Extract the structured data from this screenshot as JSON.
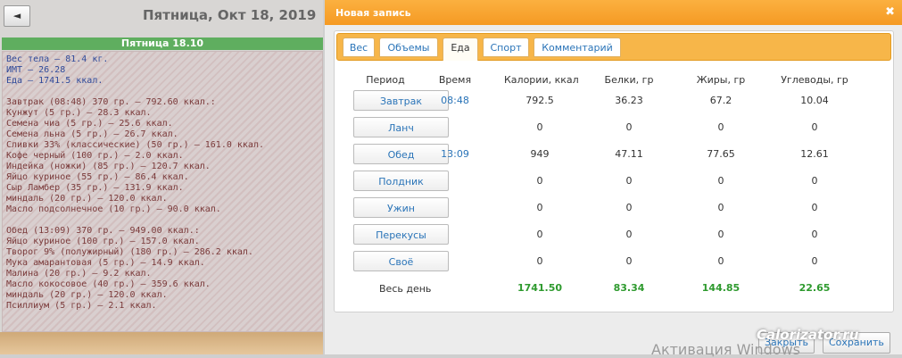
{
  "left": {
    "back_label": "◄",
    "date_title": "Пятница, Окт 18, 2019",
    "day_label": "Пятница 18.10",
    "lines": [
      {
        "text": "Вес тела — 81.4 кг.",
        "color": "blue"
      },
      {
        "text": "ИМТ — 26.28",
        "color": "blue"
      },
      {
        "text": "Еда — 1741.5 ккал.",
        "color": "blue"
      },
      {
        "text": "",
        "color": "blue"
      },
      {
        "text": "Завтрак (08:48) 370 гр. — 792.60 ккал.:",
        "color": "brown"
      },
      {
        "text": " Кунжут (5 гр.) — 28.3 ккал.",
        "color": "brown"
      },
      {
        "text": " Семена чиа (5 гр.) — 25.6 ккал.",
        "color": "brown"
      },
      {
        "text": " Семена льна (5 гр.) — 26.7 ккал.",
        "color": "brown"
      },
      {
        "text": " Сливки 33% (классические) (50 гр.) — 161.0 ккал.",
        "color": "brown"
      },
      {
        "text": " Кофе черный (100 гр.) — 2.0 ккал.",
        "color": "brown"
      },
      {
        "text": " Индейка (ножки) (85 гр.) — 120.7 ккал.",
        "color": "brown"
      },
      {
        "text": " Яйцо куриное (55 гр.) — 86.4 ккал.",
        "color": "brown"
      },
      {
        "text": " Сыр Ламбер (35 гр.) — 131.9 ккал.",
        "color": "brown"
      },
      {
        "text": " миндаль (20 гр.) — 120.0 ккал.",
        "color": "brown"
      },
      {
        "text": " Масло подсолнечное (10 гр.) — 90.0 ккал.",
        "color": "brown"
      },
      {
        "text": "",
        "color": "brown"
      },
      {
        "text": "Обед (13:09) 370 гр. — 949.00 ккал.:",
        "color": "brown"
      },
      {
        "text": " Яйцо куриное (100 гр.) — 157.0 ккал.",
        "color": "brown"
      },
      {
        "text": " Творог 9% (полужирный) (180 гр.) — 286.2 ккал.",
        "color": "brown"
      },
      {
        "text": " Мука амарантовая (5 гр.) — 14.9 ккал.",
        "color": "brown"
      },
      {
        "text": " Малина (20 гр.) — 9.2 ккал.",
        "color": "brown"
      },
      {
        "text": " Масло кокосовое (40 гр.) — 359.6 ккал.",
        "color": "brown"
      },
      {
        "text": " миндаль (20 гр.) — 120.0 ккал.",
        "color": "brown"
      },
      {
        "text": " Псиллиум (5 гр.) — 2.1 ккал.",
        "color": "brown"
      }
    ]
  },
  "dialog": {
    "title": "Новая запись",
    "close_glyph": "✖",
    "tabs": [
      "Вес",
      "Объемы",
      "Еда",
      "Спорт",
      "Комментарий"
    ],
    "active_tab": "Еда",
    "columns": [
      "Период",
      "Время",
      "Калории, ккал",
      "Белки, гр",
      "Жиры, гр",
      "Углеводы, гр"
    ],
    "rows": [
      {
        "period": "Завтрак",
        "time": "08:48",
        "cal": "792.5",
        "prot": "36.23",
        "fat": "67.2",
        "carb": "10.04"
      },
      {
        "period": "Ланч",
        "time": "",
        "cal": "0",
        "prot": "0",
        "fat": "0",
        "carb": "0"
      },
      {
        "period": "Обед",
        "time": "13:09",
        "cal": "949",
        "prot": "47.11",
        "fat": "77.65",
        "carb": "12.61"
      },
      {
        "period": "Полдник",
        "time": "",
        "cal": "0",
        "prot": "0",
        "fat": "0",
        "carb": "0"
      },
      {
        "period": "Ужин",
        "time": "",
        "cal": "0",
        "prot": "0",
        "fat": "0",
        "carb": "0"
      },
      {
        "period": "Перекусы",
        "time": "",
        "cal": "0",
        "prot": "0",
        "fat": "0",
        "carb": "0"
      },
      {
        "period": "Своё",
        "time": "",
        "cal": "0",
        "prot": "0",
        "fat": "0",
        "carb": "0"
      }
    ],
    "total": {
      "label": "Весь день",
      "cal": "1741.50",
      "prot": "83.34",
      "fat": "144.85",
      "carb": "22.65"
    },
    "buttons": {
      "close": "Закрыть",
      "save": "Сохранить"
    }
  },
  "overlay": {
    "brand": "Calorizator.ru",
    "activation": "Активация Windows"
  },
  "colors": {
    "accent": "#f7b649",
    "link": "#2a74b8",
    "total": "#2e9a2e"
  }
}
